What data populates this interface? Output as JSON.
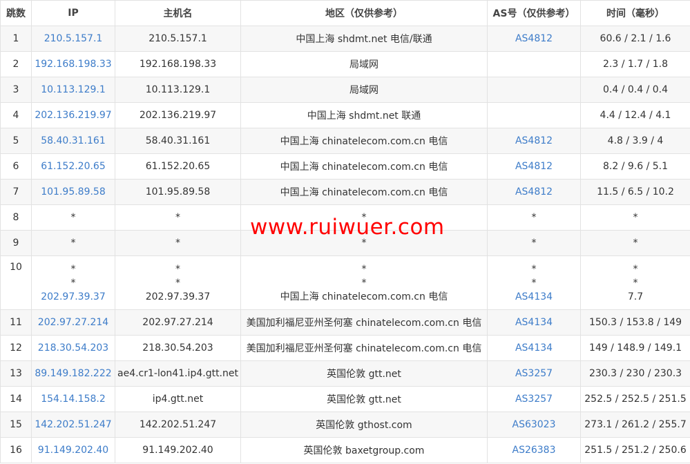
{
  "headers": {
    "hop": "跳数",
    "ip": "IP",
    "host": "主机名",
    "region": "地区（仅供参考）",
    "as": "AS号（仅供参考）",
    "time": "时间（毫秒）"
  },
  "rows": [
    {
      "hop": "1",
      "ip": "210.5.157.1",
      "host": "210.5.157.1",
      "region": "中国上海 shdmt.net 电信/联通",
      "as": "AS4812",
      "time": "60.6 / 2.1 / 1.6"
    },
    {
      "hop": "2",
      "ip": "192.168.198.33",
      "host": "192.168.198.33",
      "region": "局域网",
      "as": "",
      "time": "2.3 / 1.7 / 1.8"
    },
    {
      "hop": "3",
      "ip": "10.113.129.1",
      "host": "10.113.129.1",
      "region": "局域网",
      "as": "",
      "time": "0.4 / 0.4 / 0.4"
    },
    {
      "hop": "4",
      "ip": "202.136.219.97",
      "host": "202.136.219.97",
      "region": "中国上海 shdmt.net 联通",
      "as": "",
      "time": "4.4 / 12.4 / 4.1"
    },
    {
      "hop": "5",
      "ip": "58.40.31.161",
      "host": "58.40.31.161",
      "region": "中国上海 chinatelecom.com.cn 电信",
      "as": "AS4812",
      "time": "4.8 / 3.9 / 4"
    },
    {
      "hop": "6",
      "ip": "61.152.20.65",
      "host": "61.152.20.65",
      "region": "中国上海 chinatelecom.com.cn 电信",
      "as": "AS4812",
      "time": "8.2 / 9.6 / 5.1"
    },
    {
      "hop": "7",
      "ip": "101.95.89.58",
      "host": "101.95.89.58",
      "region": "中国上海 chinatelecom.com.cn 电信",
      "as": "AS4812",
      "time": "11.5 / 6.5 / 10.2"
    },
    {
      "hop": "8",
      "ip": "*",
      "host": "*",
      "region": "*",
      "as": "*",
      "time": "*"
    },
    {
      "hop": "9",
      "ip": "*",
      "host": "*",
      "region": "*",
      "as": "*",
      "time": "*"
    },
    {
      "hop": "10",
      "ip": [
        "*",
        "*",
        "202.97.39.37"
      ],
      "host": [
        "*",
        "*",
        "202.97.39.37"
      ],
      "region": [
        "*",
        "*",
        "中国上海 chinatelecom.com.cn 电信"
      ],
      "as": [
        "*",
        "*",
        "AS4134"
      ],
      "time": [
        "*",
        "*",
        "7.7"
      ]
    },
    {
      "hop": "11",
      "ip": "202.97.27.214",
      "host": "202.97.27.214",
      "region": "美国加利福尼亚州圣何塞 chinatelecom.com.cn 电信",
      "as": "AS4134",
      "time": "150.3 / 153.8 / 149"
    },
    {
      "hop": "12",
      "ip": "218.30.54.203",
      "host": "218.30.54.203",
      "region": "美国加利福尼亚州圣何塞 chinatelecom.com.cn 电信",
      "as": "AS4134",
      "time": "149 / 148.9 / 149.1"
    },
    {
      "hop": "13",
      "ip": "89.149.182.222",
      "host": "ae4.cr1-lon41.ip4.gtt.net",
      "region": "英国伦敦 gtt.net",
      "as": "AS3257",
      "time": "230.3 / 230 / 230.3"
    },
    {
      "hop": "14",
      "ip": "154.14.158.2",
      "host": "ip4.gtt.net",
      "region": "英国伦敦 gtt.net",
      "as": "AS3257",
      "time": "252.5 / 252.5 / 251.5"
    },
    {
      "hop": "15",
      "ip": "142.202.51.247",
      "host": "142.202.51.247",
      "region": "英国伦敦 gthost.com",
      "as": "AS63023",
      "time": "273.1 / 261.2 / 255.7"
    },
    {
      "hop": "16",
      "ip": "91.149.202.40",
      "host": "91.149.202.40",
      "region": "英国伦敦 baxetgroup.com",
      "as": "AS26383",
      "time": "251.5 / 251.2 / 250.6"
    }
  ],
  "watermark": "www.ruiwuer.com",
  "colors": {
    "link": "#3d7cc9",
    "watermark": "#ff0000",
    "zebra": "#f7f7f7",
    "border": "#e2e2e2"
  }
}
